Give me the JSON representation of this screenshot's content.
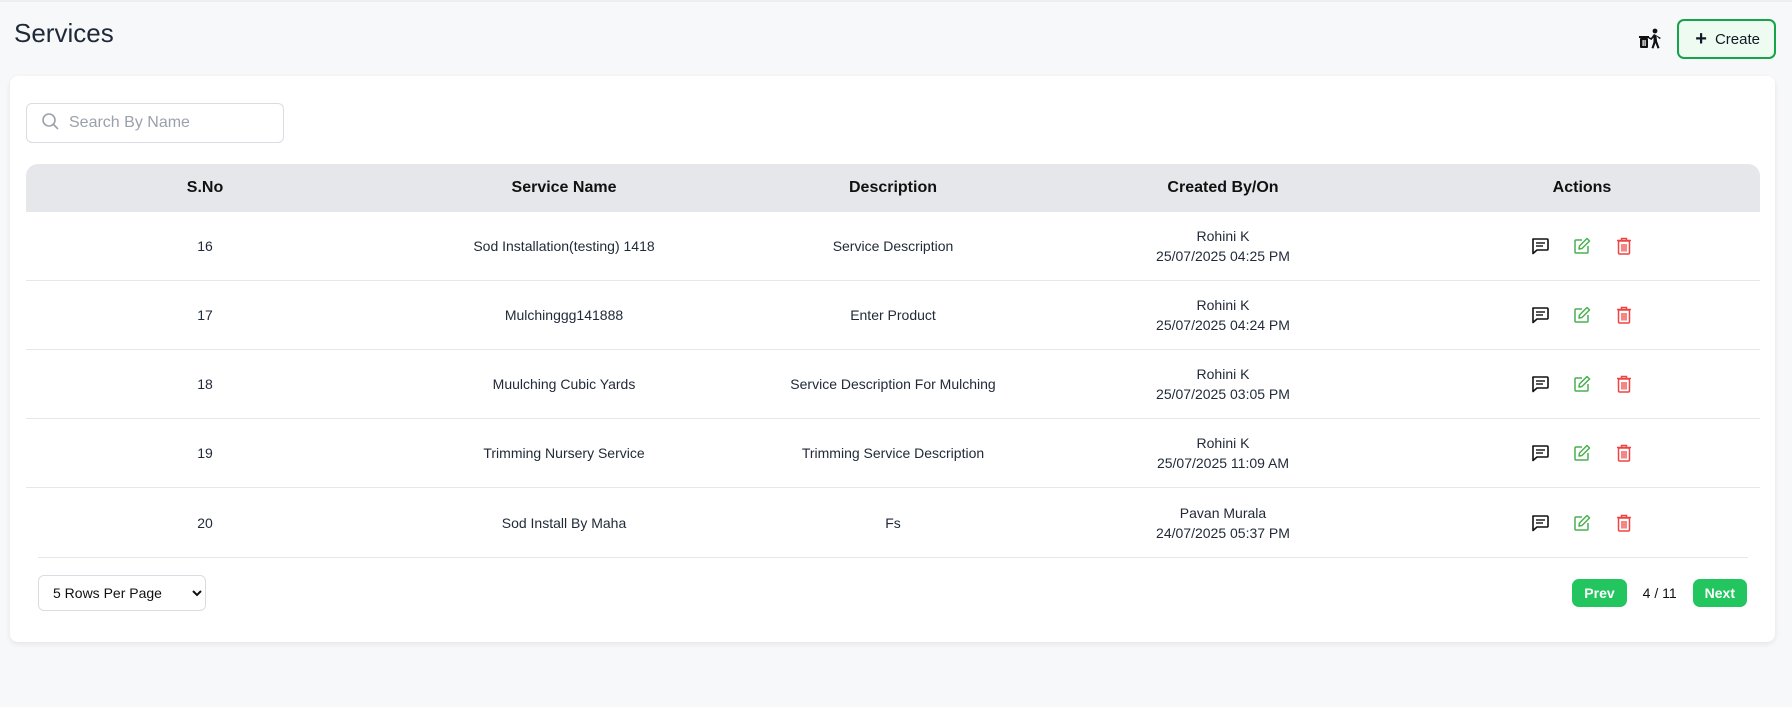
{
  "page": {
    "title": "Services"
  },
  "header": {
    "create_label": "Create"
  },
  "search": {
    "placeholder": "Search By Name"
  },
  "table": {
    "headers": {
      "sno": "S.No",
      "service_name": "Service Name",
      "description": "Description",
      "created": "Created By/On",
      "actions": "Actions"
    },
    "rows": [
      {
        "sno": "16",
        "service_name": "Sod Installation(testing) 1418",
        "description": "Service Description",
        "created_by": "Rohini K",
        "created_on": "25/07/2025 04:25 PM"
      },
      {
        "sno": "17",
        "service_name": "Mulchinggg141888",
        "description": "Enter Product",
        "created_by": "Rohini K",
        "created_on": "25/07/2025 04:24 PM"
      },
      {
        "sno": "18",
        "service_name": "Muulching Cubic Yards",
        "description": "Service Description For Mulching",
        "created_by": "Rohini K",
        "created_on": "25/07/2025 03:05 PM"
      },
      {
        "sno": "19",
        "service_name": "Trimming Nursery Service",
        "description": "Trimming Service Description",
        "created_by": "Rohini K",
        "created_on": "25/07/2025 11:09 AM"
      },
      {
        "sno": "20",
        "service_name": "Sod Install By Maha",
        "description": "Fs",
        "created_by": "Pavan Murala",
        "created_on": "24/07/2025 05:37 PM"
      }
    ]
  },
  "pagination": {
    "rows_per_page": "5 Rows Per Page",
    "prev_label": "Prev",
    "next_label": "Next",
    "page_indicator": "4 / 11"
  },
  "icons": {
    "trash_person": "trash-person-icon",
    "search": "search-icon",
    "comment": "comment-icon",
    "edit": "edit-icon",
    "delete": "delete-icon"
  },
  "colors": {
    "accent": "#22c55e",
    "edit": "#4caf50",
    "delete": "#ef4444"
  }
}
